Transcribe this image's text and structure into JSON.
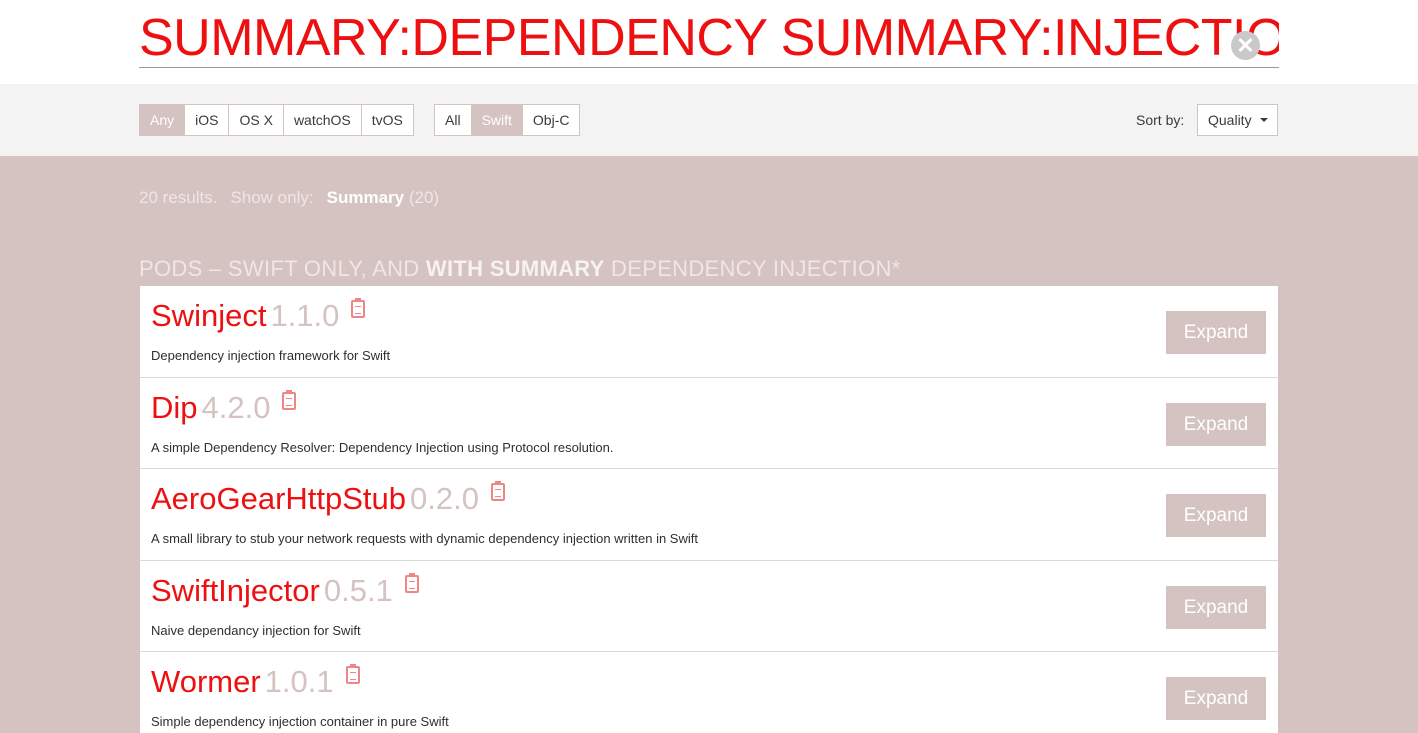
{
  "search": {
    "value": "SUMMARY:DEPENDENCY SUMMARY:INJECTION",
    "clear_glyph": "✕"
  },
  "filters": {
    "platforms": [
      {
        "label": "Any",
        "active": true
      },
      {
        "label": "iOS",
        "active": false
      },
      {
        "label": "OS X",
        "active": false
      },
      {
        "label": "watchOS",
        "active": false
      },
      {
        "label": "tvOS",
        "active": false
      }
    ],
    "languages": [
      {
        "label": "All",
        "active": false
      },
      {
        "label": "Swift",
        "active": true
      },
      {
        "label": "Obj-C",
        "active": false
      }
    ],
    "sort_label": "Sort by:",
    "sort_value": "Quality"
  },
  "results": {
    "count_text": "20 results.",
    "show_only": "Show only:",
    "category": "Summary",
    "category_count": "(20)"
  },
  "heading": {
    "part1": "PODS – SWIFT ONLY, AND ",
    "bold": "WITH SUMMARY",
    "part2": " DEPENDENCY INJECTION*"
  },
  "pods": [
    {
      "name": "Swinject",
      "version": "1.1.0",
      "summary": "Dependency injection framework for Swift",
      "action": "Expand"
    },
    {
      "name": "Dip",
      "version": "4.2.0",
      "summary": "A simple Dependency Resolver: Dependency Injection using Protocol resolution.",
      "action": "Expand"
    },
    {
      "name": "AeroGearHttpStub",
      "version": "0.2.0",
      "summary": "A small library to stub your network requests with dynamic dependency injection written in Swift",
      "action": "Expand"
    },
    {
      "name": "SwiftInjector",
      "version": "0.5.1",
      "summary": "Naive dependancy injection for Swift",
      "action": "Expand"
    },
    {
      "name": "Wormer",
      "version": "1.0.1",
      "summary": "Simple dependency injection container in pure Swift",
      "action": "Expand"
    }
  ],
  "colors": {
    "accent": "#ee1010",
    "muted": "#d5c3c1",
    "background": "#d5c3c1",
    "icon": "#f08585"
  },
  "icons": {
    "clear": "close-icon",
    "pod_action": "clipboard-icon",
    "sort": "chevron-down-icon"
  }
}
